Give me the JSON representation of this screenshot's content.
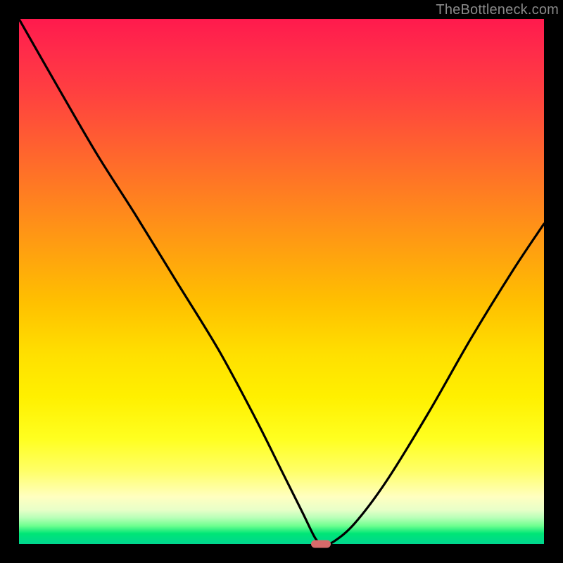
{
  "watermark": "TheBottleneck.com",
  "chart_data": {
    "type": "line",
    "title": "",
    "xlabel": "",
    "ylabel": "",
    "xlim": [
      0,
      100
    ],
    "ylim": [
      0,
      100
    ],
    "grid": false,
    "legend": false,
    "series": [
      {
        "name": "bottleneck-curve",
        "x": [
          0,
          8,
          15,
          22,
          30,
          38,
          45,
          50,
          54,
          56.5,
          58,
          60,
          64,
          70,
          78,
          86,
          94,
          100
        ],
        "y": [
          100,
          86,
          74,
          63,
          50,
          37,
          24,
          14,
          6,
          1,
          0,
          0.5,
          4,
          12,
          25,
          39,
          52,
          61
        ]
      }
    ],
    "marker": {
      "x": 57.5,
      "y": 0
    },
    "background_gradient_stops": [
      {
        "pct": 0,
        "color": "#ff1a4d"
      },
      {
        "pct": 50,
        "color": "#ffc000"
      },
      {
        "pct": 92,
        "color": "#ffffc0"
      },
      {
        "pct": 100,
        "color": "#00d68f"
      }
    ]
  }
}
